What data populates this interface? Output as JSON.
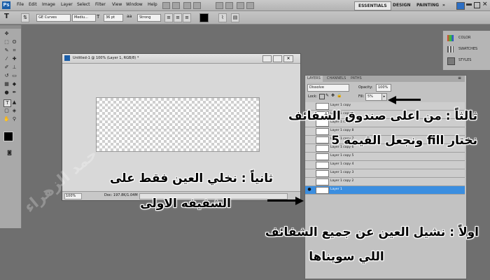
{
  "menubar": {
    "logo": "Ps",
    "items": [
      "File",
      "Edit",
      "Image",
      "Layer",
      "Select",
      "Filter",
      "View",
      "Window",
      "Help"
    ],
    "workspaces": [
      "ESSENTIALS",
      "DESIGN",
      "PAINTING"
    ],
    "more": "»"
  },
  "options": {
    "tool_glyph": "T",
    "font_family": "GE Curves",
    "font_style": "Mediu...",
    "font_size": "36 pt",
    "antialias": "Strong"
  },
  "document": {
    "title": "Untitled-1 @ 100% (Layer 1, RGB/8) *",
    "zoom": "100%",
    "doc_info": "Doc: 197.8K/1.04M"
  },
  "layers_panel": {
    "tabs": [
      "LAYERS",
      "CHANNELS",
      "PATHS"
    ],
    "blend_mode": "Dissolve",
    "opacity_label": "Opacity:",
    "opacity_value": "100%",
    "lock_label": "Lock:",
    "fill_label": "Fill:",
    "fill_value": "5%",
    "layers": [
      {
        "name": "Layer 1 copy",
        "visible": false,
        "selected": false
      },
      {
        "name": "Layer 1 copy",
        "visible": false,
        "selected": false
      },
      {
        "name": "Layer 1 copy 9",
        "visible": false,
        "selected": false
      },
      {
        "name": "Layer 1 copy 8",
        "visible": false,
        "selected": false
      },
      {
        "name": "Layer 1 copy 7",
        "visible": false,
        "selected": false
      },
      {
        "name": "Layer 1 copy 6",
        "visible": false,
        "selected": false
      },
      {
        "name": "Layer 1 copy 5",
        "visible": false,
        "selected": false
      },
      {
        "name": "Layer 1 copy 4",
        "visible": false,
        "selected": false
      },
      {
        "name": "Layer 1 copy 3",
        "visible": false,
        "selected": false
      },
      {
        "name": "Layer 1 copy 2",
        "visible": false,
        "selected": false
      },
      {
        "name": "Layer 1",
        "visible": true,
        "selected": true
      }
    ]
  },
  "right_panels": [
    "COLOR",
    "SWATCHES",
    "STYLES"
  ],
  "annotations": {
    "step3_line1": "ثالثاً : من اعلى صندوق الشفائف",
    "step3_line2": "نختار fill ونجعل القيمه 5",
    "step2_line1": "ثانياً : نخلي العين فقط على",
    "step2_line2": "الشفيفه الاولى",
    "step1_line1": "اولاً : نشيل العين عن جميع الشفائف",
    "step1_line2": "اللي سويناها"
  },
  "watermark": "حمد الزهراء",
  "colors": {
    "workspace_bg": "#6f6f6f",
    "selected_layer": "#3b8ee0",
    "annotation_text": "#000000"
  }
}
